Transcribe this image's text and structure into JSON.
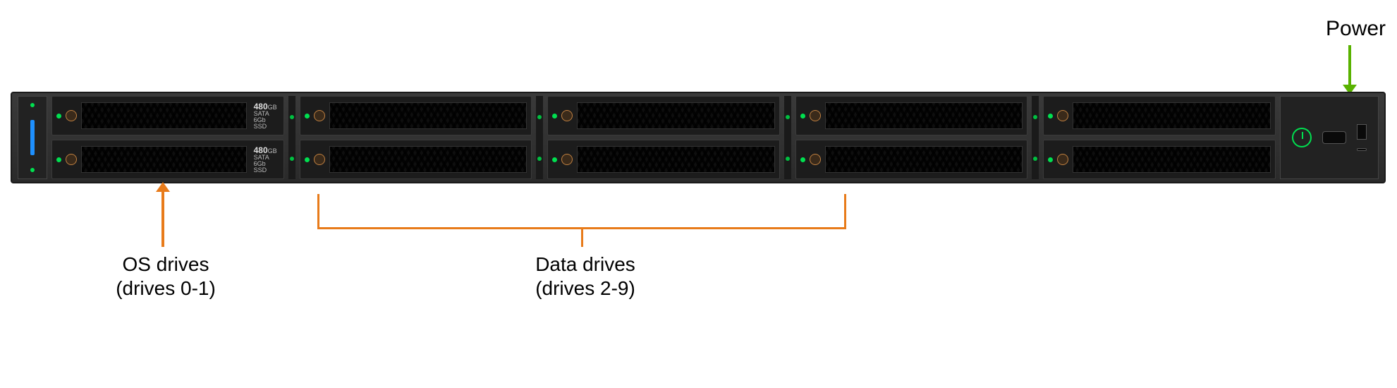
{
  "annotations": {
    "power": {
      "label": "Power"
    },
    "os_drives": {
      "line1": "OS drives",
      "line2": "(drives 0-1)"
    },
    "data_drives": {
      "line1": "Data drives",
      "line2": "(drives 2-9)"
    }
  },
  "server": {
    "form_factor": "1U rack server front view",
    "drive_bays": {
      "layout": "10 x 2.5\" hot-swap bays (5 columns × 2 rows)",
      "os_drive_indices": [
        0,
        1
      ],
      "data_drive_indices": [
        2,
        3,
        4,
        5,
        6,
        7,
        8,
        9
      ],
      "visible_drive_label": {
        "capacity": "480",
        "capacity_unit": "GB",
        "line2": "SATA",
        "line3": "6Gb",
        "line4": "SSD"
      }
    },
    "right_panel": {
      "elements": [
        "power-button",
        "vga-port",
        "usb-port",
        "usb-c-port"
      ]
    },
    "left_ear": {
      "elements": [
        "status-led-strip",
        "info-button"
      ]
    }
  },
  "colors": {
    "annotation_orange": "#e87b1a",
    "annotation_green": "#59b200",
    "led_green": "#00e050",
    "status_blue": "#1e90ff"
  }
}
